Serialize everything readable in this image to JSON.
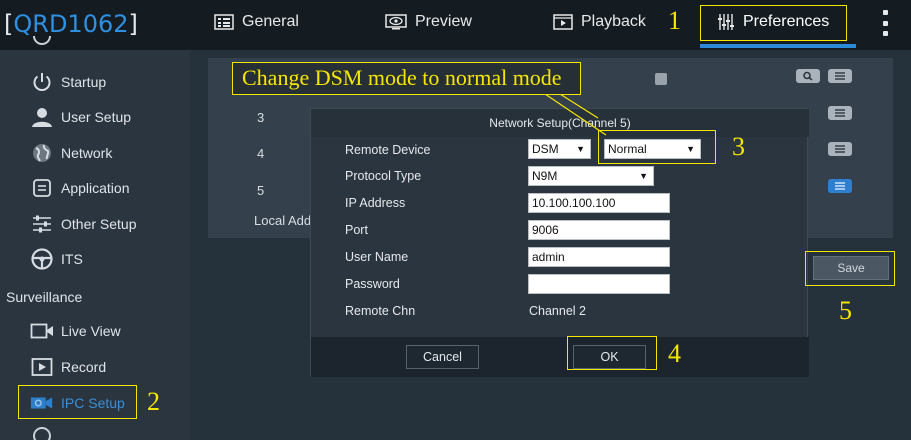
{
  "header": {
    "brand_open": "[",
    "brand_name": "QRD1062",
    "brand_close": "]",
    "tabs": [
      {
        "label": "General",
        "icon": "grid-icon"
      },
      {
        "label": "Preview",
        "icon": "eye-icon"
      },
      {
        "label": "Playback",
        "icon": "film-icon"
      },
      {
        "label": "Preferences",
        "icon": "sliders-icon",
        "active": true
      }
    ],
    "more_icon": "kebab-icon"
  },
  "sidebar": {
    "items": [
      {
        "label": "Startup",
        "icon": "power-icon"
      },
      {
        "label": "User Setup",
        "icon": "user-icon"
      },
      {
        "label": "Network",
        "icon": "globe-icon"
      },
      {
        "label": "Application",
        "icon": "app-icon"
      },
      {
        "label": "Other Setup",
        "icon": "sliders-icon"
      },
      {
        "label": "ITS",
        "icon": "wheel-icon"
      }
    ],
    "group_label": "Surveillance",
    "surveillance_items": [
      {
        "label": "Live View",
        "icon": "camera-icon"
      },
      {
        "label": "Record",
        "icon": "record-icon"
      },
      {
        "label": "IPC Setup",
        "icon": "ipc-icon",
        "active": true
      }
    ]
  },
  "main": {
    "rows": [
      "3",
      "4",
      "5"
    ],
    "local_address_label": "Local Add",
    "save_label": "Save"
  },
  "dialog": {
    "title": "Network Setup(Channel 5)",
    "fields": {
      "remote_device_label": "Remote Device",
      "remote_device_value": "DSM",
      "mode_value": "Normal",
      "protocol_label": "Protocol Type",
      "protocol_value": "N9M",
      "ip_label": "IP Address",
      "ip_value": "10.100.100.100",
      "port_label": "Port",
      "port_value": "9006",
      "user_label": "User Name",
      "user_value": "admin",
      "password_label": "Password",
      "password_value": "",
      "chn_label": "Remote Chn",
      "chn_value": "Channel 2"
    },
    "cancel_label": "Cancel",
    "ok_label": "OK"
  },
  "annotations": {
    "callout": "Change DSM mode to normal mode",
    "step1": "1",
    "step2": "2",
    "step3": "3",
    "step4": "4",
    "step5": "5",
    "color": "#f5e600"
  },
  "colors": {
    "accent": "#2b8ad6",
    "topbar": "#141c22",
    "sidebar": "#2a3540"
  }
}
